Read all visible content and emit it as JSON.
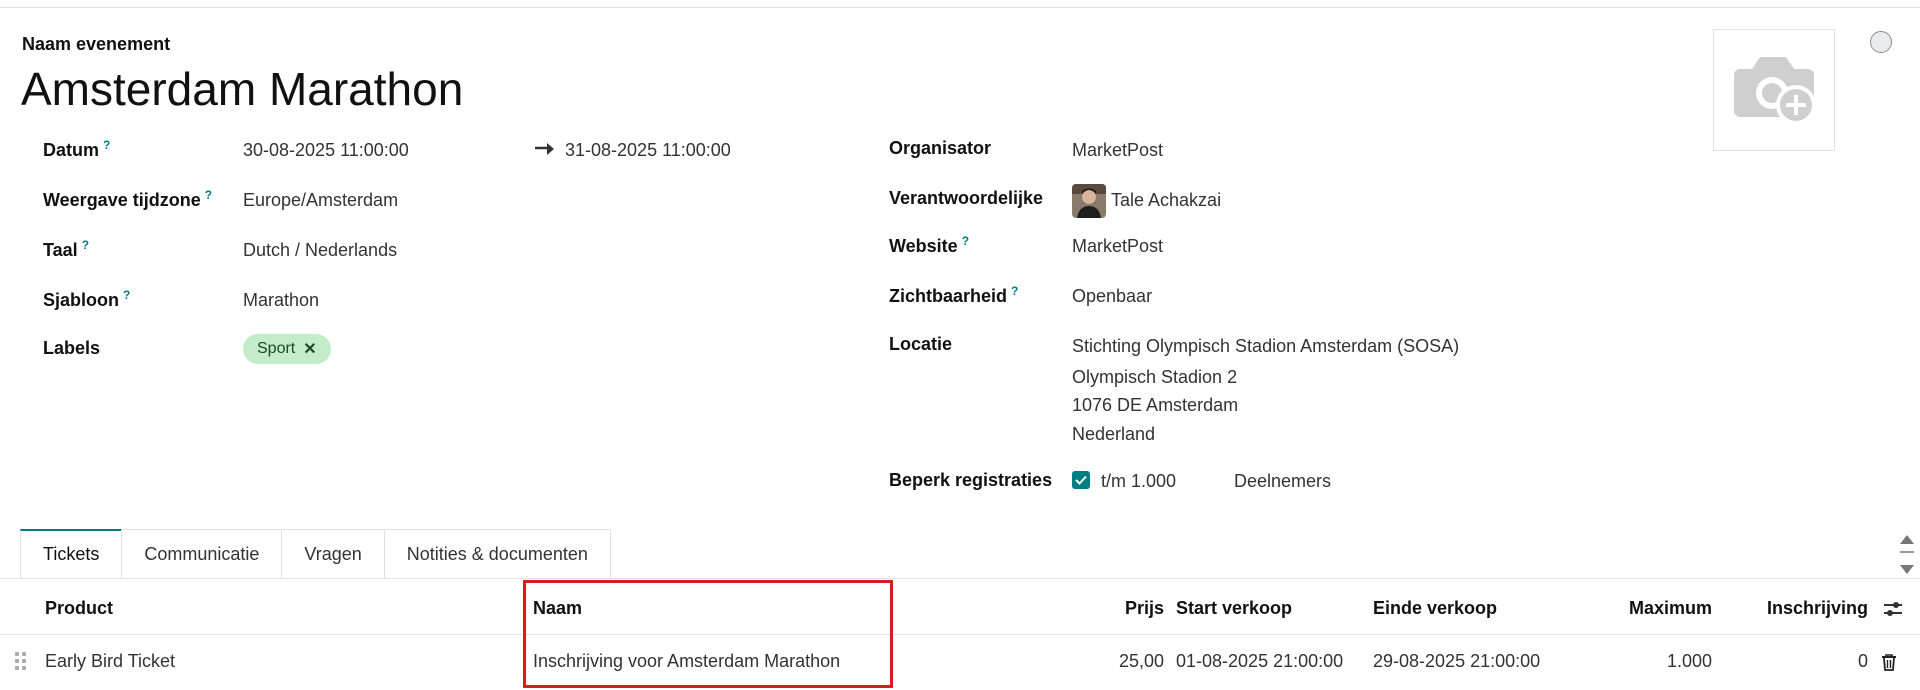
{
  "event": {
    "name_label": "Naam evenement",
    "title": "Amsterdam Marathon"
  },
  "left_fields": {
    "datum": {
      "label": "Datum",
      "help": "?",
      "start": "30-08-2025 11:00:00",
      "end": "31-08-2025 11:00:00"
    },
    "tijdzone": {
      "label": "Weergave tijdzone",
      "help": "?",
      "value": "Europe/Amsterdam"
    },
    "taal": {
      "label": "Taal",
      "help": "?",
      "value": "Dutch / Nederlands"
    },
    "sjabloon": {
      "label": "Sjabloon",
      "help": "?",
      "value": "Marathon"
    },
    "labels": {
      "label": "Labels",
      "tags": [
        "Sport"
      ],
      "remove_glyph": "✕"
    }
  },
  "right_fields": {
    "organisator": {
      "label": "Organisator",
      "value": "MarketPost"
    },
    "verantwoordelijke": {
      "label": "Verantwoordelijke",
      "value": "Tale Achakzai"
    },
    "website": {
      "label": "Website",
      "help": "?",
      "value": "MarketPost"
    },
    "zichtbaarheid": {
      "label": "Zichtbaarheid",
      "help": "?",
      "value": "Openbaar"
    },
    "locatie": {
      "label": "Locatie",
      "lines": [
        "Stichting Olympisch Stadion Amsterdam (SOSA)",
        "Olympisch Stadion 2",
        "1076 DE Amsterdam",
        "Nederland"
      ]
    },
    "beperk": {
      "label": "Beperk registraties",
      "checked": true,
      "limit": "t/m 1.000",
      "unit": "Deelnemers"
    }
  },
  "tabs": [
    {
      "label": "Tickets",
      "active": true
    },
    {
      "label": "Communicatie",
      "active": false
    },
    {
      "label": "Vragen",
      "active": false
    },
    {
      "label": "Notities & documenten",
      "active": false
    }
  ],
  "table": {
    "columns": [
      "Product",
      "Naam",
      "Prijs",
      "Start verkoop",
      "Einde verkoop",
      "Maximum",
      "Inschrijving"
    ],
    "rows": [
      [
        "Early Bird Ticket",
        "Inschrijving voor Amsterdam Marathon",
        "25,00",
        "01-08-2025 21:00:00",
        "29-08-2025 21:00:00",
        "1.000",
        "0"
      ]
    ]
  },
  "icons": {
    "photo": "camera-add-icon",
    "status": "status-circle-icon",
    "arrow": "arrow-right-icon",
    "check": "checkbox-checked-icon",
    "settings": "optional-columns-icon",
    "trash": "trash-icon",
    "drag": "drag-handle-icon"
  },
  "colors": {
    "accent": "#017e84",
    "tag_bg": "#c3ecc9",
    "highlight": "#e0191f"
  }
}
